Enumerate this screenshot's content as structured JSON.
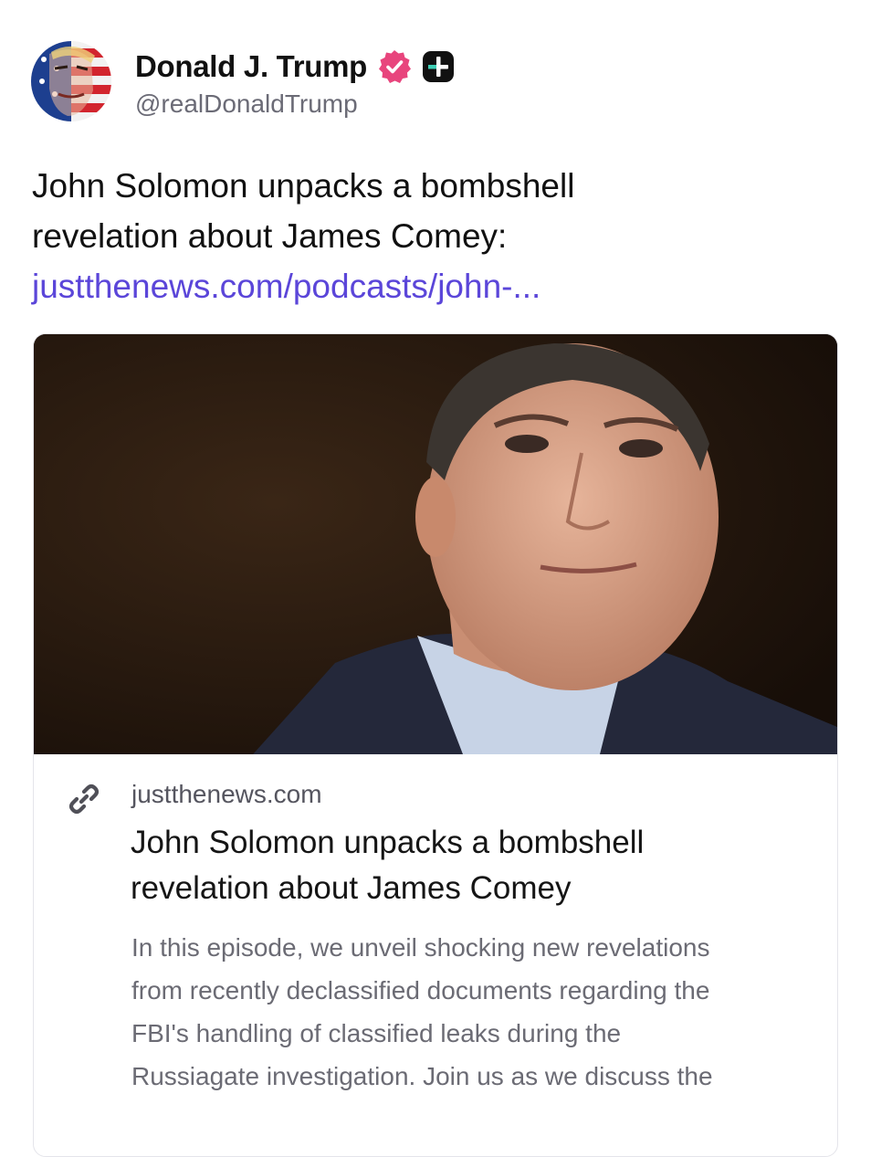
{
  "post": {
    "author": {
      "display_name": "Donald J. Trump",
      "handle": "@realDonaldTrump",
      "verified_icon": "verified-badge-icon",
      "plus_icon": "plus-badge-icon"
    },
    "text_lines": [
      "John Solomon unpacks a bombshell",
      "revelation about James Comey:"
    ],
    "link_text": "justthenews.com/podcasts/john-..."
  },
  "link_card": {
    "icon": "link-icon",
    "domain": "justthenews.com",
    "title_lines": [
      "John Solomon unpacks a bombshell",
      "revelation about James Comey"
    ],
    "description_lines": [
      "In this episode, we unveil shocking new revelations",
      "from recently declassified documents regarding the",
      "FBI's handling of classified leaks during the",
      "Russiagate investigation. Join us as we discuss the"
    ]
  },
  "colors": {
    "link": "#5b46d9",
    "verified_badge": "#e8457d",
    "text_primary": "#111111",
    "text_secondary": "#6b6b76"
  }
}
